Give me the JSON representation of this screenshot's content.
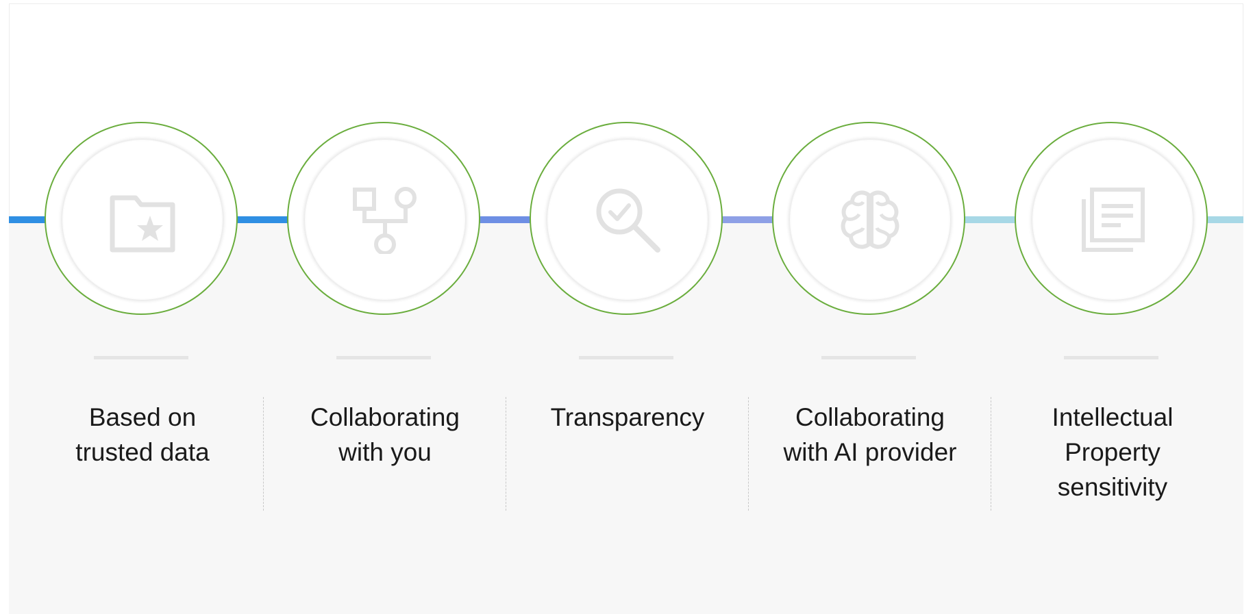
{
  "colors": {
    "ring": "#6aad3d",
    "icon": "#e2e2e2",
    "text": "#1a1a1a",
    "connectors": [
      "#2f8fe3",
      "#2f8fe3",
      "#6e8fe4",
      "#8ea0e6",
      "#a7d8e6",
      "#a7d8e6"
    ]
  },
  "steps": [
    {
      "icon": "folder-star-icon",
      "lines": [
        "Based on",
        "trusted data"
      ]
    },
    {
      "icon": "flowchart-icon",
      "lines": [
        "Collaborating",
        "with you"
      ]
    },
    {
      "icon": "magnifier-check-icon",
      "lines": [
        "Transparency"
      ]
    },
    {
      "icon": "brain-icon",
      "lines": [
        "Collaborating",
        "with AI provider"
      ]
    },
    {
      "icon": "documents-icon",
      "lines": [
        "Intellectual",
        "Property",
        "sensitivity"
      ]
    }
  ]
}
